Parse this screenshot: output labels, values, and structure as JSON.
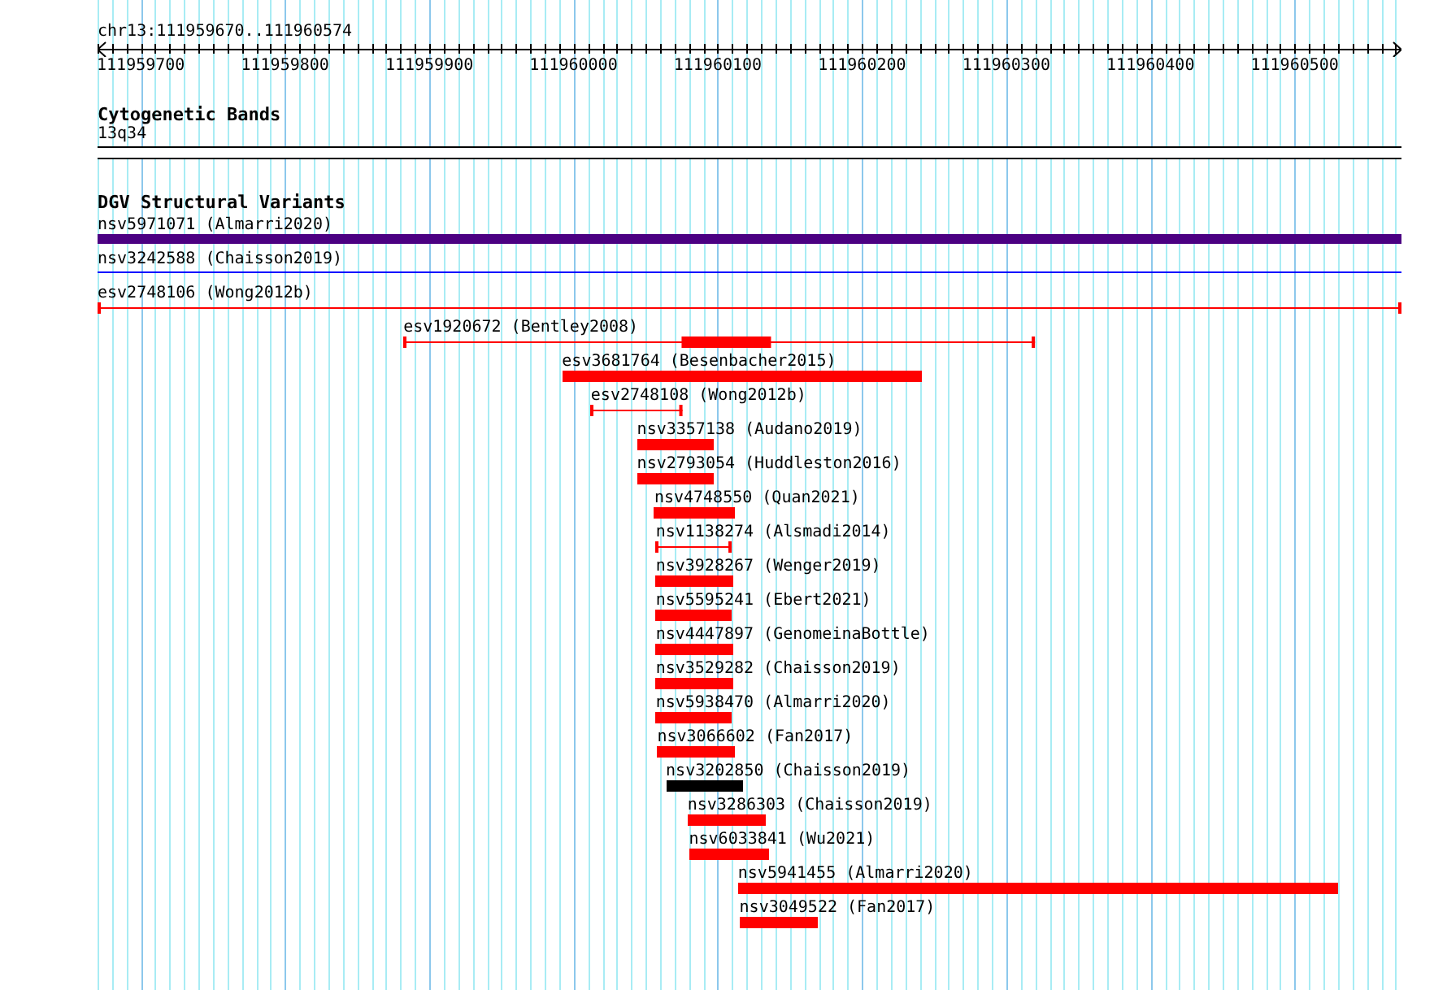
{
  "ruler": {
    "location": "chr13:111959670..111960574",
    "ticks": [
      "111959700",
      "111959800",
      "111959900",
      "111960000",
      "111960100",
      "111960200",
      "111960300",
      "111960400",
      "111960500"
    ]
  },
  "cytogenetic_track": {
    "title": "Cytogenetic Bands",
    "band": "13q34"
  },
  "variant_track": {
    "title": "DGV Structural Variants",
    "features": [
      {
        "label": "nsv5971071 (Almarri2020)",
        "kind": "thick",
        "color": "#4b0082"
      },
      {
        "label": "nsv3242588 (Chaisson2019)",
        "kind": "line",
        "color": "#0000ff"
      },
      {
        "label": "esv2748106 (Wong2012b)",
        "kind": "span",
        "color": "#ff0000"
      },
      {
        "label": "esv1920672 (Bentley2008)",
        "kind": "span_core",
        "color": "#ff0000"
      },
      {
        "label": "esv3681764 (Besenbacher2015)",
        "kind": "block",
        "color": "#ff0000"
      },
      {
        "label": "esv2748108 (Wong2012b)",
        "kind": "span",
        "color": "#ff0000"
      },
      {
        "label": "nsv3357138 (Audano2019)",
        "kind": "block",
        "color": "#ff0000"
      },
      {
        "label": "nsv2793054 (Huddleston2016)",
        "kind": "block",
        "color": "#ff0000"
      },
      {
        "label": "nsv4748550 (Quan2021)",
        "kind": "block",
        "color": "#ff0000"
      },
      {
        "label": "nsv1138274 (Alsmadi2014)",
        "kind": "span",
        "color": "#ff0000"
      },
      {
        "label": "nsv3928267 (Wenger2019)",
        "kind": "block",
        "color": "#ff0000"
      },
      {
        "label": "nsv5595241 (Ebert2021)",
        "kind": "block",
        "color": "#ff0000"
      },
      {
        "label": "nsv4447897 (GenomeinaBottle)",
        "kind": "block",
        "color": "#ff0000"
      },
      {
        "label": "nsv3529282 (Chaisson2019)",
        "kind": "block",
        "color": "#ff0000"
      },
      {
        "label": "nsv5938470 (Almarri2020)",
        "kind": "block",
        "color": "#ff0000"
      },
      {
        "label": "nsv3066602 (Fan2017)",
        "kind": "block",
        "color": "#ff0000"
      },
      {
        "label": "nsv3202850 (Chaisson2019)",
        "kind": "block",
        "color": "#000000"
      },
      {
        "label": "nsv3286303 (Chaisson2019)",
        "kind": "block",
        "color": "#ff0000"
      },
      {
        "label": "nsv6033841 (Wu2021)",
        "kind": "block",
        "color": "#ff0000"
      },
      {
        "label": "nsv5941455 (Almarri2020)",
        "kind": "block",
        "color": "#ff0000"
      },
      {
        "label": "nsv3049522 (Fan2017)",
        "kind": "block",
        "color": "#ff0000"
      }
    ]
  }
}
